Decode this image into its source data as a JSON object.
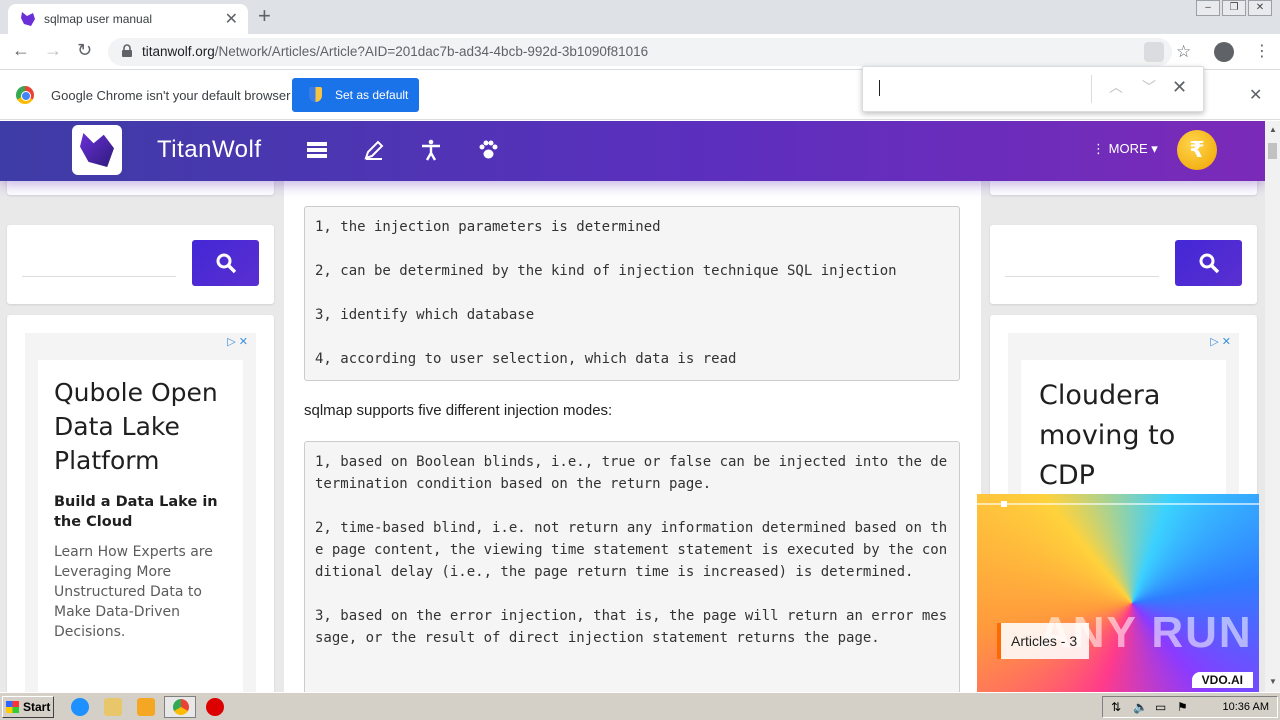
{
  "browser": {
    "tab_title": "sqlmap user manual",
    "url_host": "titanwolf.org",
    "url_path": "/Network/Articles/Article?AID=201dac7b-ad34-4bcb-992d-3b1090f81016",
    "infobar_message": "Google Chrome isn't your default browser",
    "set_default_label": "Set as default"
  },
  "site": {
    "brand": "TitanWolf",
    "more_label": "MORE",
    "coin_symbol": "₹",
    "nav_icons": [
      "list-icon",
      "edit-icon",
      "accessibility-icon",
      "paw-icon"
    ]
  },
  "article": {
    "steps_code": "1, the injection parameters is determined\n\n2, can be determined by the kind of injection technique SQL injection\n\n3, identify which database\n\n4, according to user selection, which data is read",
    "modes_intro": "sqlmap supports five different injection modes:",
    "modes_code": "1, based on Boolean blinds, i.e., true or false can be injected into the determination condition based on the return page.\n\n2, time-based blind, i.e. not return any information determined based on the page content, the viewing time statement statement is executed by the conditional delay (i.e., the page return time is increased) is determined.\n\n3, based on the error injection, that is, the page will return an error message, or the result of direct injection statement returns the page."
  },
  "ads": {
    "left": {
      "title": "Qubole Open Data Lake Platform",
      "subtitle": "Build a Data Lake in the Cloud",
      "body": "Learn How Experts are Leveraging More Unstructured Data to Make Data-Driven Decisions."
    },
    "right": {
      "title": "Cloudera moving to CDP"
    }
  },
  "video": {
    "chip_label": "Articles - 3",
    "vdo_label": "VDO.AI",
    "watermark": "ANY RUN"
  },
  "taskbar": {
    "start_label": "Start",
    "clock": "10:36 AM"
  }
}
